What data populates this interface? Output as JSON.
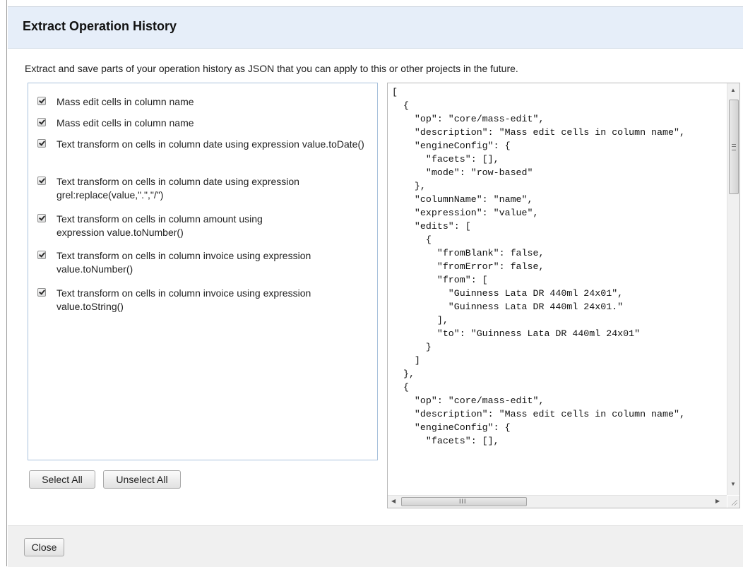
{
  "dialog": {
    "title": "Extract Operation History",
    "description": "Extract and save parts of your operation history as JSON that you can apply to this or other projects in the future.",
    "operations": [
      {
        "label": "Mass edit cells in column name",
        "checked": true
      },
      {
        "label": "Mass edit cells in column name",
        "checked": true
      },
      {
        "label": "Text transform on cells in column date using expression value.toDate()",
        "checked": true
      },
      {
        "label": "Text transform on cells in column date using expression grel:replace(value,\".\",\"/\")",
        "checked": true
      },
      {
        "label": "Text transform on cells in column amount using expression value.toNumber()",
        "checked": true
      },
      {
        "label": "Text transform on cells in column invoice using expression value.toNumber()",
        "checked": true
      },
      {
        "label": "Text transform on cells in column invoice using expression value.toString()",
        "checked": true
      }
    ],
    "select_all_label": "Select All",
    "unselect_all_label": "Unselect All",
    "json_text": "[\n  {\n    \"op\": \"core/mass-edit\",\n    \"description\": \"Mass edit cells in column name\",\n    \"engineConfig\": {\n      \"facets\": [],\n      \"mode\": \"row-based\"\n    },\n    \"columnName\": \"name\",\n    \"expression\": \"value\",\n    \"edits\": [\n      {\n        \"fromBlank\": false,\n        \"fromError\": false,\n        \"from\": [\n          \"Guinness Lata DR 440ml 24x01\",\n          \"Guinness Lata DR 440ml 24x01.\"\n        ],\n        \"to\": \"Guinness Lata DR 440ml 24x01\"\n      }\n    ]\n  },\n  {\n    \"op\": \"core/mass-edit\",\n    \"description\": \"Mass edit cells in column name\",\n    \"engineConfig\": {\n      \"facets\": [],",
    "close_label": "Close",
    "scroll_arrows": {
      "up": "▲",
      "down": "▼",
      "left": "◀",
      "right": "▶",
      "hgrip": "III"
    }
  }
}
